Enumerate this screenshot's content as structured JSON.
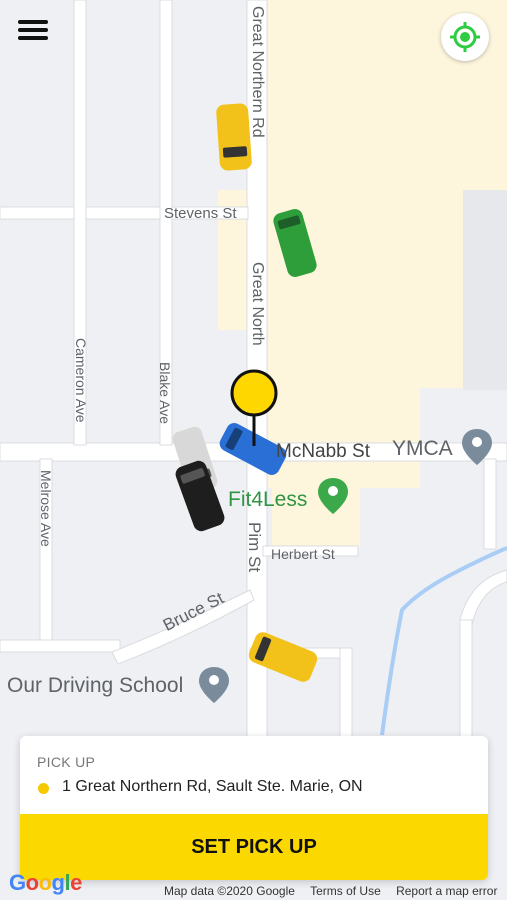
{
  "map": {
    "streets": [
      "Great Northern Rd",
      "Stevens St",
      "Great North",
      "Cameron Ave",
      "Blake Ave",
      "McNabb St",
      "Melrose Ave",
      "Pim St",
      "Herbert St",
      "Bruce St"
    ],
    "pois": [
      "YMCA",
      "Fit4Less",
      "Our Driving School"
    ],
    "car_colors": [
      "#f2c21b",
      "#2e9e3a",
      "#2a6fd6",
      "#d8d8d8",
      "#1e1e1e",
      "#f2c21b"
    ],
    "pin_color": "#ffd700",
    "poi_icon_colors": {
      "ymca": "#7a8c9c",
      "fit4less": "#3ba94a",
      "driving_school": "#7a8c9c"
    }
  },
  "header": {
    "menu_icon": "hamburger-icon",
    "locate_icon": "crosshair-icon",
    "accent": "#2ecc40"
  },
  "pickup": {
    "label": "PICK UP",
    "address": "1 Great Northern Rd, Sault Ste. Marie, ON",
    "button_label": "SET PICK UP",
    "accent": "#fbd900"
  },
  "footer": {
    "logo": "Google",
    "map_data": "Map data ©2020 Google",
    "terms": "Terms of Use",
    "report": "Report a map error"
  }
}
